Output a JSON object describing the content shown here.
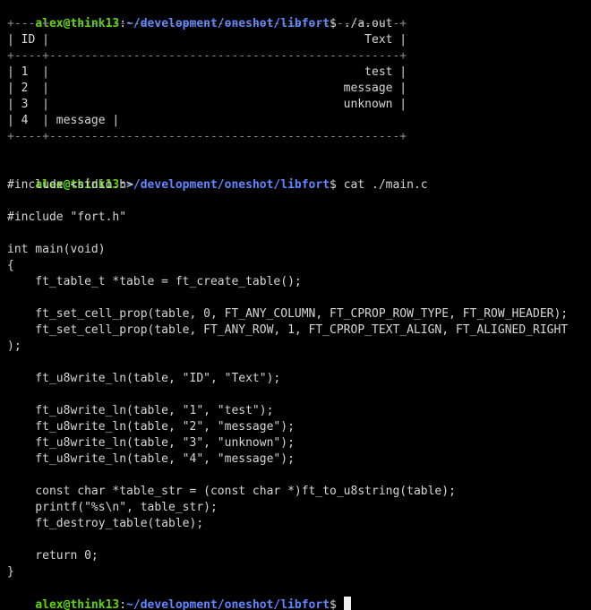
{
  "colors": {
    "background": "#000000",
    "foreground": "#d6d6d6",
    "table_border": "#8a8a8a",
    "prompt_user": "#5fd700",
    "prompt_path": "#5f87ff"
  },
  "prompt": {
    "user_host": "alex@think13",
    "separator": ":",
    "path": "~/development/oneshot/libfort",
    "symbol": "$"
  },
  "commands": {
    "run": " ./a.out",
    "cat": " cat ./main.c",
    "empty": " "
  },
  "table_output": {
    "border_top": "+----+--------------------------------------------------+",
    "header_row": "| ID |                                             Text |",
    "header_sep": "+----+--------------------------------------------------+",
    "rows": [
      "| 1  |                                             test |",
      "| 2  |                                          message |",
      "| 3  |                                          unknown |",
      "| 4  | message |"
    ],
    "border_bottom": "+----+--------------------------------------------------+"
  },
  "source_lines": [
    "#include <stdio.h>",
    "",
    "#include \"fort.h\"",
    "",
    "int main(void)",
    "{",
    "    ft_table_t *table = ft_create_table();",
    "",
    "    ft_set_cell_prop(table, 0, FT_ANY_COLUMN, FT_CPROP_ROW_TYPE, FT_ROW_HEADER);",
    "    ft_set_cell_prop(table, FT_ANY_ROW, 1, FT_CPROP_TEXT_ALIGN, FT_ALIGNED_RIGHT",
    ");",
    "",
    "    ft_u8write_ln(table, \"ID\", \"Text\");",
    "",
    "    ft_u8write_ln(table, \"1\", \"test\");",
    "    ft_u8write_ln(table, \"2\", \"message\");",
    "    ft_u8write_ln(table, \"3\", \"unknown\");",
    "    ft_u8write_ln(table, \"4\", \"message\");",
    "",
    "    const char *table_str = (const char *)ft_to_u8string(table);",
    "    printf(\"%s\\n\", table_str);",
    "    ft_destroy_table(table);",
    "",
    "    return 0;",
    "}"
  ]
}
